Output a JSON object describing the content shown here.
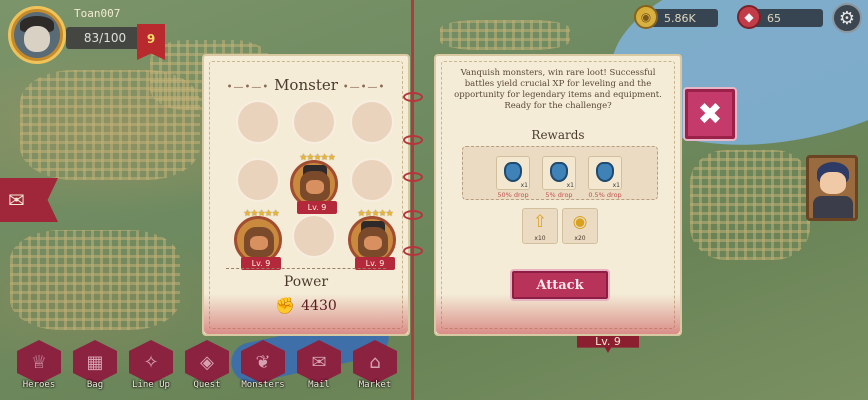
{
  "hud": {
    "player_name": "Toan007",
    "hp": "83/100",
    "level": "9",
    "gold": "5.86K",
    "gems": "65",
    "settings_icon": "gear-icon",
    "chat_icon": "chat-icon"
  },
  "monster_panel": {
    "title": "Monster",
    "title_deco_left": "•—•—•",
    "title_deco_right": "•—•—•",
    "monsters": [
      {
        "level": "Lv. 9",
        "stars": "★★★★★"
      },
      {
        "level": "Lv. 9",
        "stars": "★★★★★"
      },
      {
        "level": "Lv. 9",
        "stars": "★★★★★"
      }
    ],
    "power_label": "Power",
    "power_value": "4430"
  },
  "info_panel": {
    "description": "Vanquish monsters, win rare loot! Successful battles yield crucial XP for leveling and the opportunity for legendary items and equipment. Ready for the challenge?",
    "rewards_title": "Rewards",
    "rewards": [
      {
        "drop": "50% drop",
        "qty": "x1"
      },
      {
        "drop": "5% drop",
        "qty": "x1"
      },
      {
        "drop": "0.5% drop",
        "qty": "x1"
      }
    ],
    "resources": [
      {
        "icon": "xp-arrow-icon",
        "glyph": "⇧",
        "qty": "x10"
      },
      {
        "icon": "gold-coin-icon",
        "glyph": "◉",
        "qty": "x20"
      }
    ],
    "attack_label": "Attack",
    "close_glyph": "✖"
  },
  "map_level_tag": "Lv. 9",
  "nav": {
    "items": [
      {
        "label": "Heroes",
        "glyph": "♕"
      },
      {
        "label": "Bag",
        "glyph": "▦"
      },
      {
        "label": "Line Up",
        "glyph": "✧"
      },
      {
        "label": "Quest",
        "glyph": "◈"
      },
      {
        "label": "Monsters",
        "glyph": "❦"
      },
      {
        "label": "Mail",
        "glyph": "✉"
      },
      {
        "label": "Market",
        "glyph": "⌂"
      }
    ]
  },
  "colors": {
    "accent": "#b7335a",
    "panel": "#f4ecd7",
    "banner_red": "#b92a2e",
    "nav_hex": "#8a2240"
  }
}
